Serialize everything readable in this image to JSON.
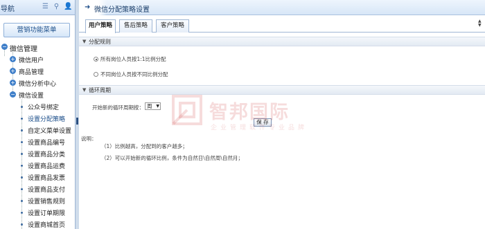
{
  "nav": {
    "title": "导航",
    "menu_button": "营销功能菜单",
    "tree": [
      {
        "label": "微信管理",
        "level": 0
      },
      {
        "label": "微信用户",
        "level": 1
      },
      {
        "label": "商品管理",
        "level": 1
      },
      {
        "label": "微信分析中心",
        "level": 1
      },
      {
        "label": "微信设置",
        "level": 1
      },
      {
        "label": "公众号绑定",
        "level": 2
      },
      {
        "label": "设置分配策略",
        "level": 2
      },
      {
        "label": "自定义菜单设置",
        "level": 2
      },
      {
        "label": "设置商品编号",
        "level": 2
      },
      {
        "label": "设置商品分类",
        "level": 2
      },
      {
        "label": "设置商品运费",
        "level": 2
      },
      {
        "label": "设置商品发票",
        "level": 2
      },
      {
        "label": "设置商品支付",
        "level": 2
      },
      {
        "label": "设置销售规则",
        "level": 2
      },
      {
        "label": "设置订单期限",
        "level": 2
      },
      {
        "label": "设置商城首页",
        "level": 2
      }
    ]
  },
  "header": {
    "title": "微信分配策略设置"
  },
  "tabs": [
    {
      "label": "用户策略",
      "active": true
    },
    {
      "label": "售后策略",
      "active": false
    },
    {
      "label": "客户策略",
      "active": false
    }
  ],
  "rules": {
    "section_title": "分配规则",
    "options": [
      {
        "label": "所有岗位人员按1:1比例分配",
        "selected": true
      },
      {
        "label": "不同岗位人员按不同比例分配",
        "selected": false
      }
    ]
  },
  "cycle": {
    "section_title": "循环周期",
    "label": "开始新的循环周期按：",
    "value": "周",
    "save": "保 存"
  },
  "notes": {
    "label": "说明：",
    "items": [
      "（1）比例越高，分配到的客户越多；",
      "（2）可以开始新的循环比例，条件为自然日\\自然周\\自然月；"
    ]
  },
  "watermark": {
    "name": "智邦国际",
    "tagline": "企业管理软件专业品牌"
  },
  "colors": {
    "accent": "#3f7fc9",
    "nav_text": "#1c3f6b",
    "border": "#9fb6d4",
    "watermark": "#c82828"
  }
}
